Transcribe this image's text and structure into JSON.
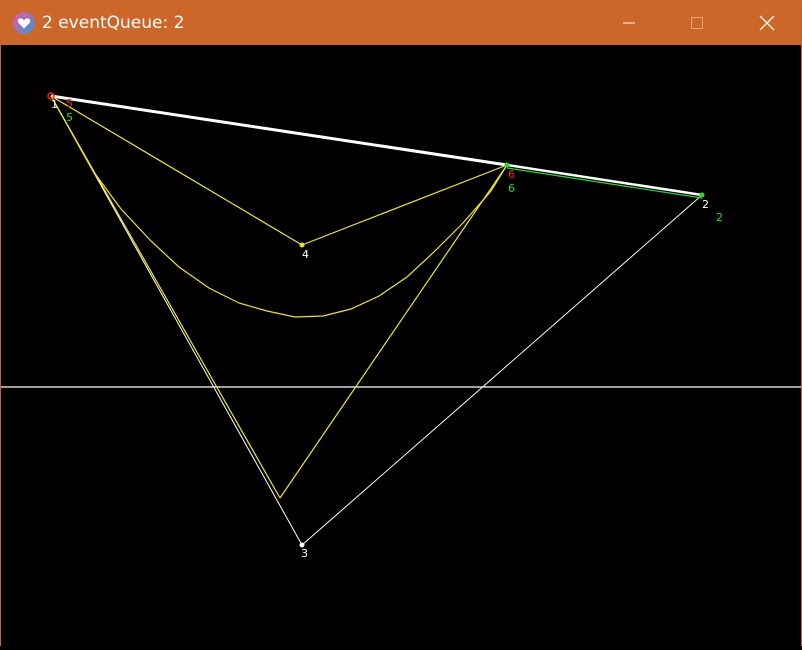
{
  "window": {
    "title": "2 eventQueue: 2",
    "controls": {
      "minimize": "minimize-icon",
      "maximize": "maximize-icon",
      "close": "close-icon"
    },
    "colors": {
      "titlebar": "#cc6629",
      "canvas": "#000000"
    }
  },
  "canvas": {
    "labels": {
      "p1_white": "1",
      "p1_red": "5",
      "p1_green": "5",
      "p2_white": "2",
      "p2_green": "2",
      "p3_white": "3",
      "p4_white": "4",
      "p6_red": "6",
      "p6_green": "6"
    },
    "colors": {
      "white": "#ffffff",
      "yellow": "#f2e51a",
      "red": "#ff2020",
      "green": "#22dd22"
    }
  }
}
